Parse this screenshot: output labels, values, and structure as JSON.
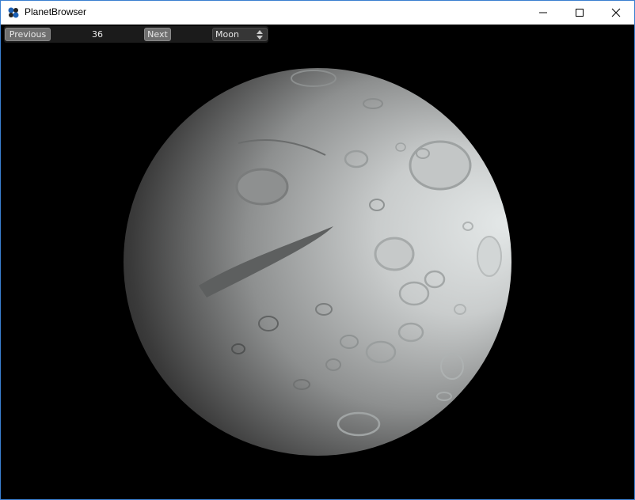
{
  "window": {
    "title": "PlanetBrowser",
    "icons": {
      "app": "planet-browser-app-icon",
      "minimize": "minimize-icon",
      "maximize": "maximize-icon",
      "close": "close-icon"
    }
  },
  "toolbar": {
    "previous_label": "Previous",
    "counter_value": "36",
    "next_label": "Next",
    "planet_select": {
      "selected": "Moon",
      "icon": "spinner-arrows-icon"
    }
  },
  "scene": {
    "subject": "Moon",
    "background_color": "#000000",
    "surface_color": "#d8dcdc"
  }
}
